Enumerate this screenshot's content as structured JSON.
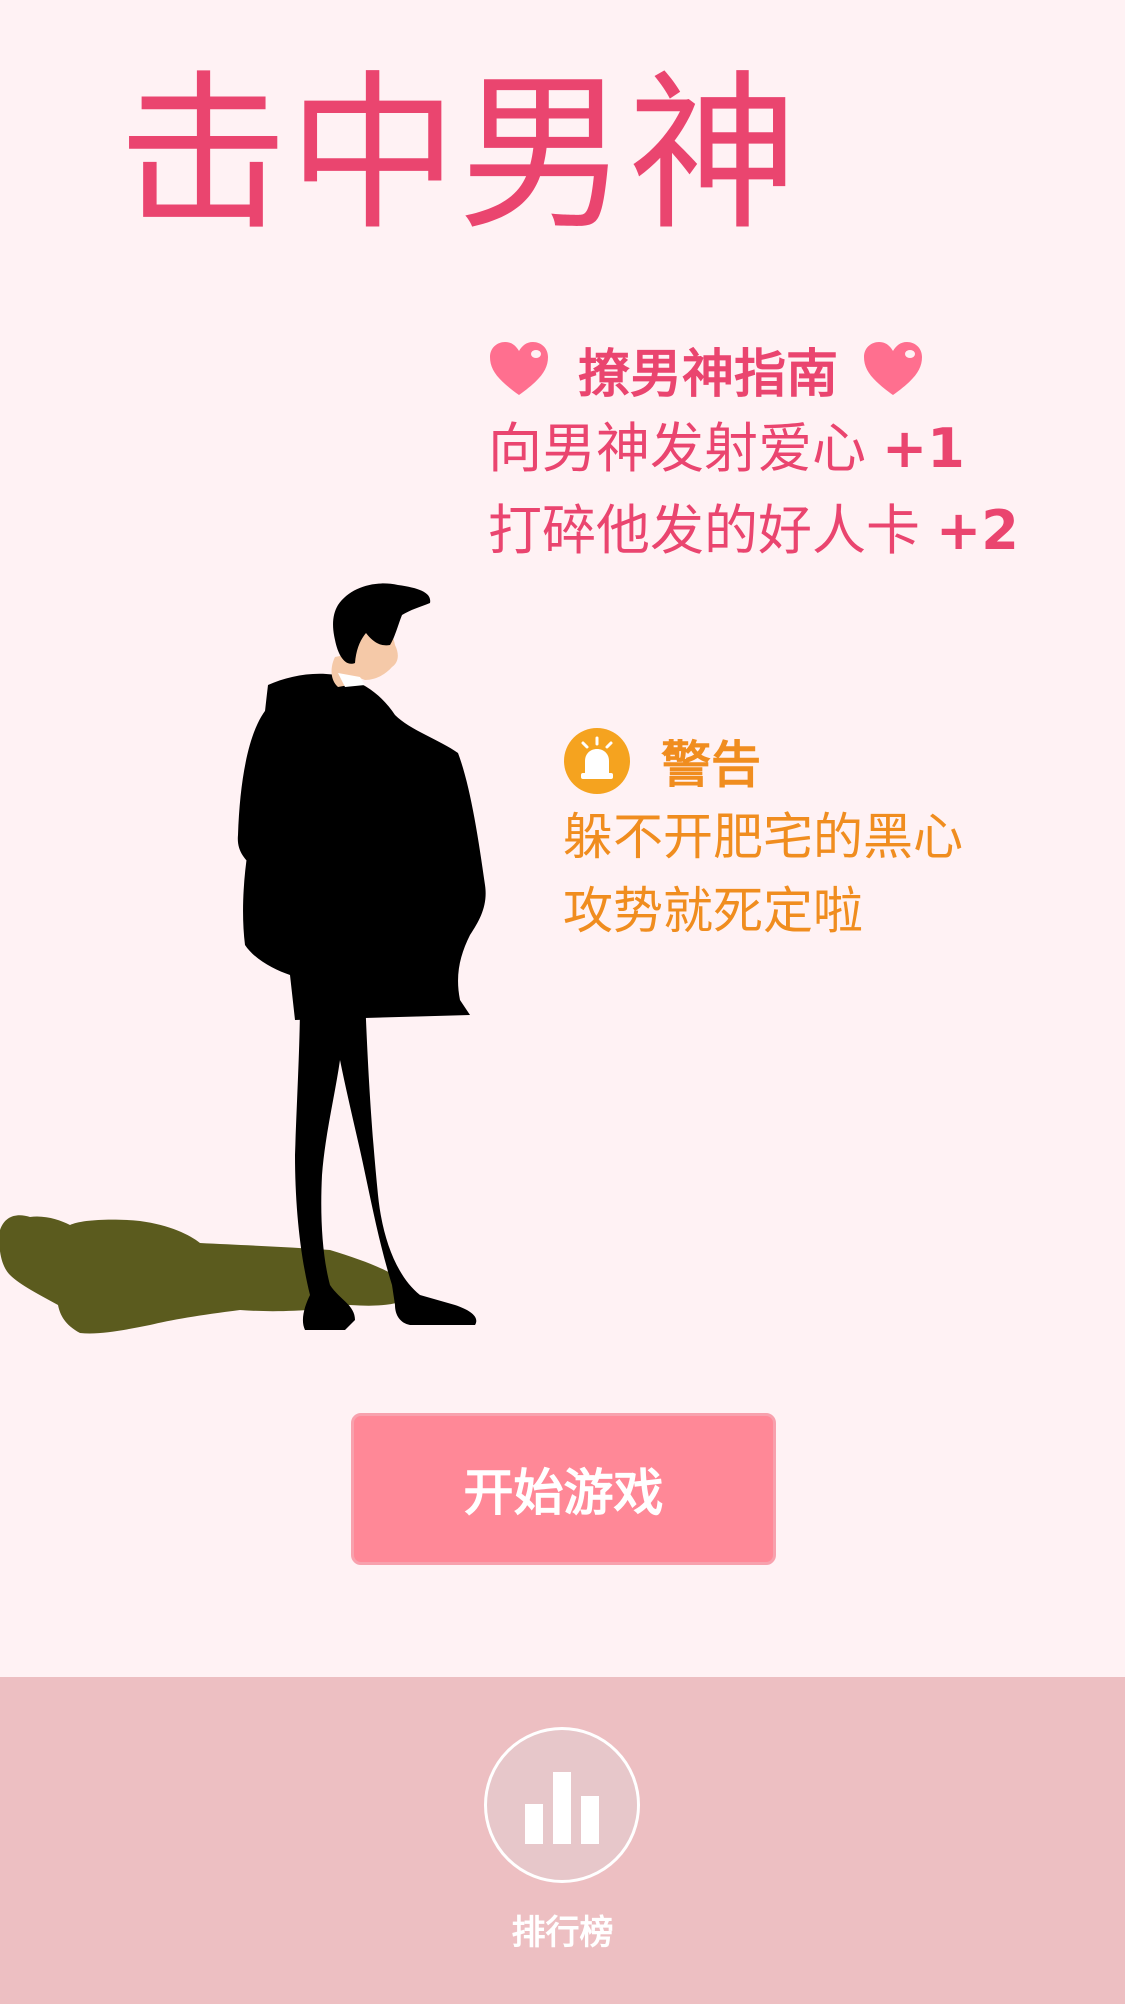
{
  "title": "击中男神",
  "guide": {
    "title": "撩男神指南",
    "line1_text": "向男神发射爱心",
    "line1_score": "+1",
    "line2_text": "打碎他发的好人卡",
    "line2_score": "+2",
    "heart_icon": "heart-icon",
    "color": "#ea456f"
  },
  "warning": {
    "title": "警告",
    "line1": "躲不开肥宅的黑心",
    "line2": "攻势就死定啦",
    "icon": "alarm-light-icon",
    "color": "#f08d1f"
  },
  "start_button": {
    "label": "开始游戏",
    "color": "#ff8897"
  },
  "bottom_bar": {
    "rank_label": "排行榜",
    "rank_icon": "bar-chart-icon",
    "background": "#edbfc2"
  }
}
